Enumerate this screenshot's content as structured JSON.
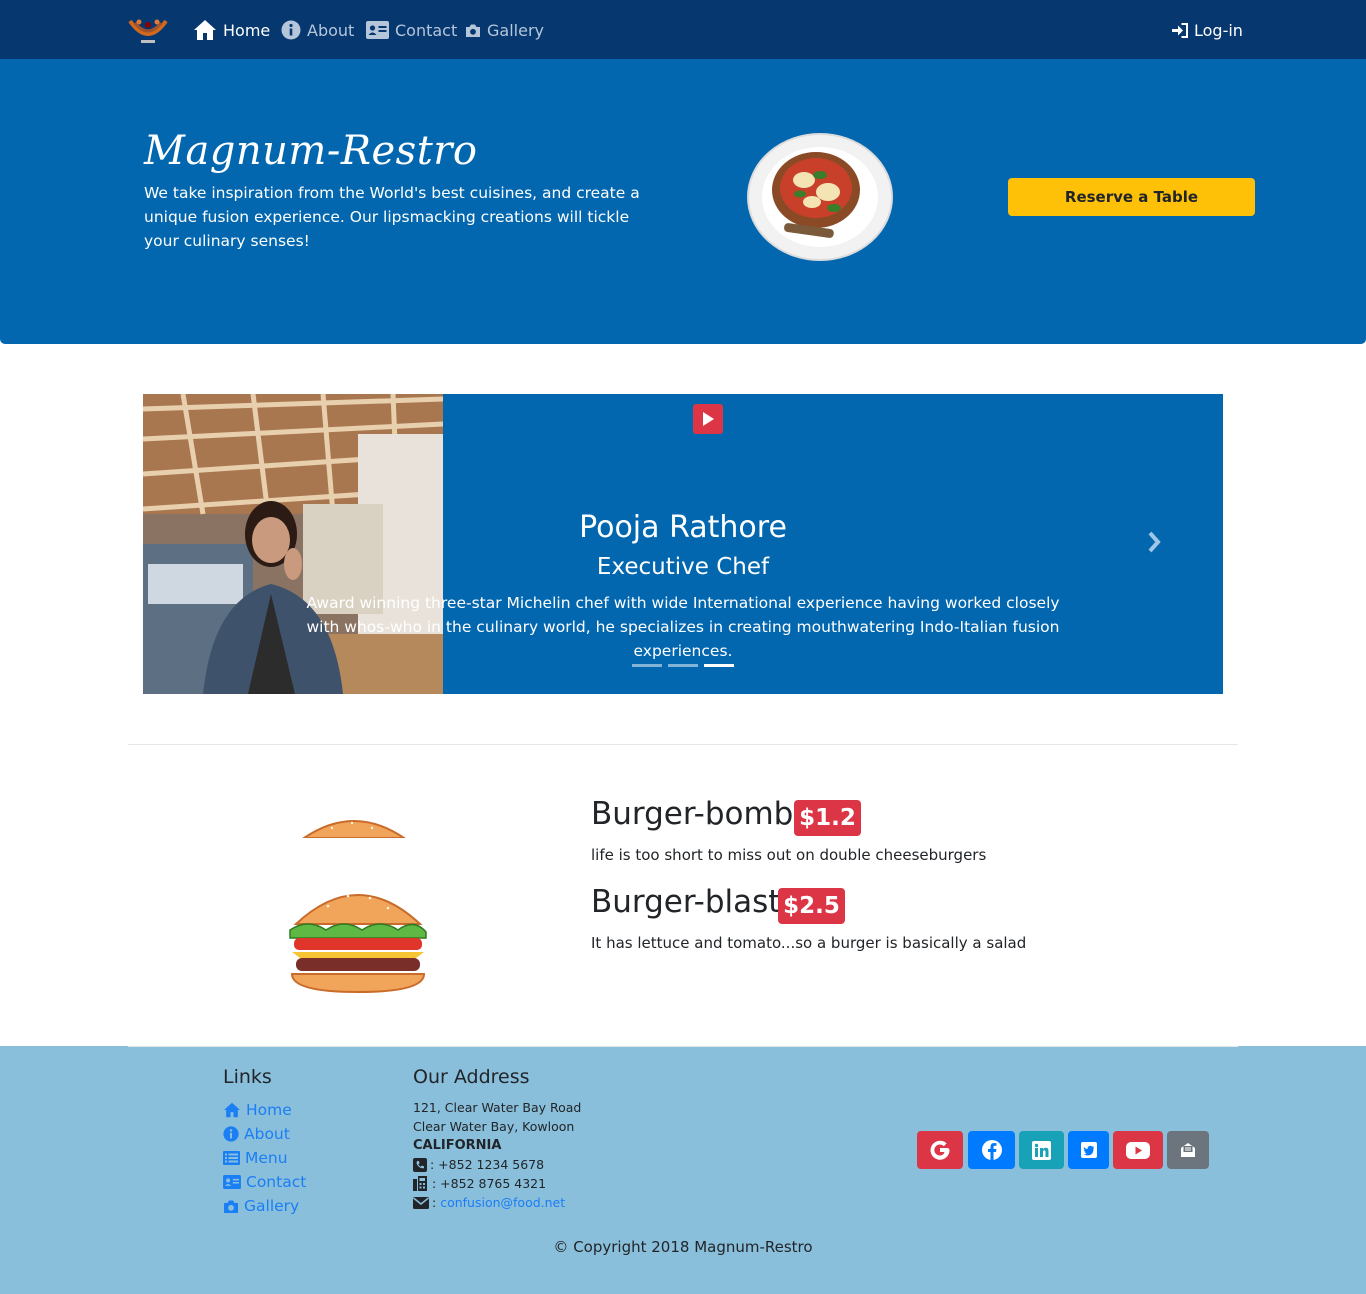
{
  "nav": {
    "home": "Home",
    "about": "About",
    "contact": "Contact",
    "gallery": "Gallery",
    "login": "Log-in"
  },
  "jumbotron": {
    "title": "Magnum-Restro",
    "description": "We take inspiration from the World's best cuisines, and create a unique fusion experience. Our lipsmacking creations will tickle your culinary senses!",
    "reserve_label": "Reserve a Table"
  },
  "carousel": {
    "name": "Pooja Rathore",
    "role": "Executive Chef",
    "description": "Award winning three-star Michelin chef with wide International experience having worked closely with whos-who in the culinary world, he specializes in creating mouthwatering Indo-Italian fusion experiences.",
    "indicator_count": 3,
    "active_index": 2
  },
  "menu": {
    "items": [
      {
        "name": "Burger-bomb",
        "price": "$1.2",
        "description": "life is too short to miss out on double cheeseburgers"
      },
      {
        "name": "Burger-blast",
        "price": "$2.5",
        "description": "It has lettuce and tomato...so a burger is basically a salad"
      }
    ]
  },
  "footer": {
    "links_title": "Links",
    "links": [
      {
        "label": "Home",
        "icon": "home-icon"
      },
      {
        "label": "About",
        "icon": "info-icon"
      },
      {
        "label": "Menu",
        "icon": "list-icon"
      },
      {
        "label": "Contact",
        "icon": "address-card-icon"
      },
      {
        "label": "Gallery",
        "icon": "camera-icon"
      }
    ],
    "address_title": "Our Address",
    "address_line1": "121, Clear Water Bay Road",
    "address_line2": "Clear Water Bay, Kowloon",
    "address_line3": "CALIFORNIA",
    "phone": ": +852 1234 5678",
    "fax": ": +852 8765 4321",
    "email_prefix": ":",
    "email": "confusion@food.net",
    "social": [
      {
        "name": "google",
        "color": "#dc3545"
      },
      {
        "name": "facebook",
        "color": "#007bff"
      },
      {
        "name": "linkedin",
        "color": "#17a2b8"
      },
      {
        "name": "twitter",
        "color": "#007bff"
      },
      {
        "name": "youtube",
        "color": "#dc3545"
      },
      {
        "name": "mail",
        "color": "#6c757d"
      }
    ],
    "copyright": "© Copyright 2018 Magnum-Restro"
  },
  "colors": {
    "navbar": "#06376f",
    "jumbotron": "#0267af",
    "accent_yellow": "#ffc107",
    "badge_red": "#dc3545",
    "footer": "#8abfdb",
    "link_blue": "#1a7ef5"
  }
}
